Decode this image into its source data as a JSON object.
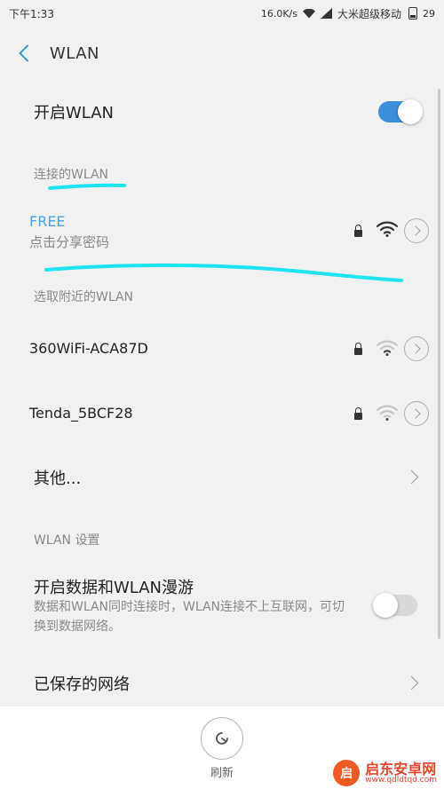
{
  "status_bar": {
    "time": "下午1:33",
    "speed": "16.0K/s",
    "carrier": "大米超级移动",
    "battery": "29"
  },
  "header": {
    "title": "WLAN"
  },
  "wlan_toggle": {
    "label": "开启WLAN",
    "on": true
  },
  "connected_section": {
    "label": "连接的WLAN",
    "network": {
      "name": "FREE",
      "subtitle": "点击分享密码"
    }
  },
  "nearby_section": {
    "label": "选取附近的WLAN",
    "networks": [
      {
        "name": "360WiFi-ACA87D"
      },
      {
        "name": "Tenda_5BCF28"
      }
    ]
  },
  "other": {
    "label": "其他..."
  },
  "settings_section": {
    "label": "WLAN 设置"
  },
  "roaming": {
    "label": "开启数据和WLAN漫游",
    "description": "数据和WLAN同时连接时，WLAN连接不上互联网，可切换到数据网络。",
    "on": false
  },
  "saved_networks": {
    "label": "已保存的网络"
  },
  "bottom_bar": {
    "refresh_label": "刷新"
  },
  "watermark": {
    "logo": "启",
    "title": "启东安卓网",
    "url": "www.qdldtqd.com"
  },
  "colors": {
    "accent": "#3d8edc",
    "connected": "#48a2ee",
    "annotation": "#1ee4f0"
  }
}
